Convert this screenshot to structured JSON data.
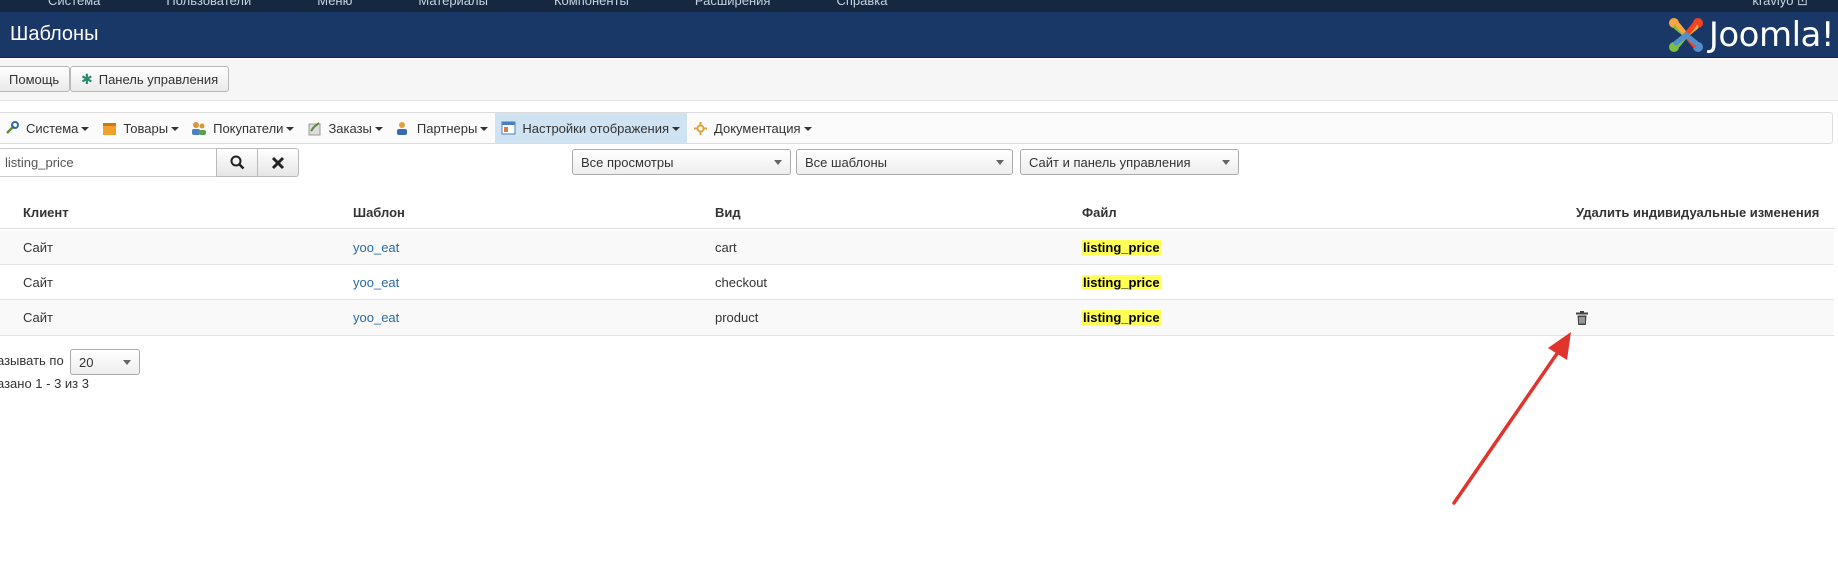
{
  "topbar": {
    "menu": [
      "Система",
      "Пользователи",
      "Меню",
      "Материалы",
      "Компоненты",
      "Расширения",
      "Справка"
    ],
    "right": "kravlyo ⊡"
  },
  "header": {
    "title": "Шаблоны",
    "logo_text": "Joomla!"
  },
  "toolbar": {
    "help_label": "Помощь",
    "panel_label": "Панель управления"
  },
  "nav": {
    "items": [
      {
        "label": "Система",
        "icon": "tools-icon"
      },
      {
        "label": "Товары",
        "icon": "box-icon"
      },
      {
        "label": "Покупатели",
        "icon": "users-icon"
      },
      {
        "label": "Заказы",
        "icon": "orders-icon"
      },
      {
        "label": "Партнеры",
        "icon": "partners-icon"
      },
      {
        "label": "Настройки отображения",
        "icon": "display-settings-icon",
        "active": true
      },
      {
        "label": "Документация",
        "icon": "docs-icon"
      }
    ]
  },
  "filters": {
    "search_value": "listing_price",
    "views_select": "Все просмотры",
    "templates_select": "Все шаблоны",
    "client_select": "Сайт и панель управления"
  },
  "table": {
    "headers": {
      "client": "Клиент",
      "template": "Шаблон",
      "view": "Вид",
      "file": "Файл",
      "delete": "Удалить индивидуальные изменения"
    },
    "rows": [
      {
        "client": "Сайт",
        "template": "yoo_eat",
        "view": "cart",
        "file": "listing_price",
        "has_delete": false
      },
      {
        "client": "Сайт",
        "template": "yoo_eat",
        "view": "checkout",
        "file": "listing_price",
        "has_delete": false
      },
      {
        "client": "Сайт",
        "template": "yoo_eat",
        "view": "product",
        "file": "listing_price",
        "has_delete": true
      }
    ]
  },
  "pagination": {
    "show_label": "азывать по",
    "per_page": "20",
    "count_label": "азано 1 - 3 из 3"
  },
  "colors": {
    "header_bg": "#1a3867",
    "topbar_bg": "#16283f",
    "active_nav": "#cfe3f2",
    "highlight": "#ffff55",
    "arrow": "#e0342c",
    "link": "#2a6aa9"
  }
}
